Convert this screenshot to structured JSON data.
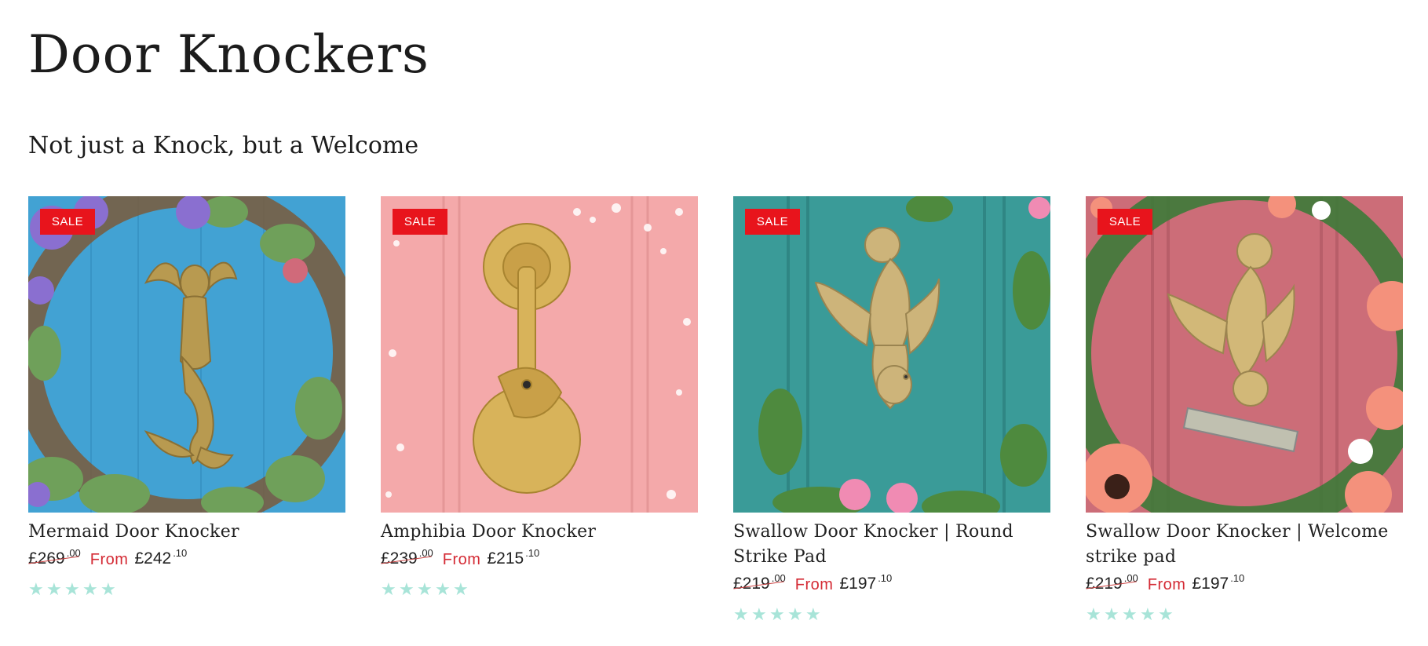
{
  "page": {
    "title": "Door Knockers",
    "subtitle": "Not just a Knock, but a Welcome"
  },
  "colors": {
    "sale_badge": "#e8141c",
    "from_label": "#d42a34",
    "star": "#a8e4d8"
  },
  "products": [
    {
      "badge": "SALE",
      "title": "Mermaid Door Knocker",
      "price_old": "£269",
      "price_old_pence": ".00",
      "from_label": "From",
      "price_new": "£242",
      "price_new_pence": ".10",
      "rating": 5,
      "image": "mermaid-knocker-photo"
    },
    {
      "badge": "SALE",
      "title": "Amphibia Door Knocker",
      "price_old": "£239",
      "price_old_pence": ".00",
      "from_label": "From",
      "price_new": "£215",
      "price_new_pence": ".10",
      "rating": 5,
      "image": "frog-knocker-photo"
    },
    {
      "badge": "SALE",
      "title": "Swallow Door Knocker | Round Strike Pad",
      "price_old": "£219",
      "price_old_pence": ".00",
      "from_label": "From",
      "price_new": "£197",
      "price_new_pence": ".10",
      "rating": 5,
      "image": "swallow-knocker-teal-photo"
    },
    {
      "badge": "SALE",
      "title": "Swallow Door Knocker | Welcome strike pad",
      "price_old": "£219",
      "price_old_pence": ".00",
      "from_label": "From",
      "price_new": "£197",
      "price_new_pence": ".10",
      "rating": 5,
      "image": "swallow-knocker-pink-photo"
    }
  ]
}
